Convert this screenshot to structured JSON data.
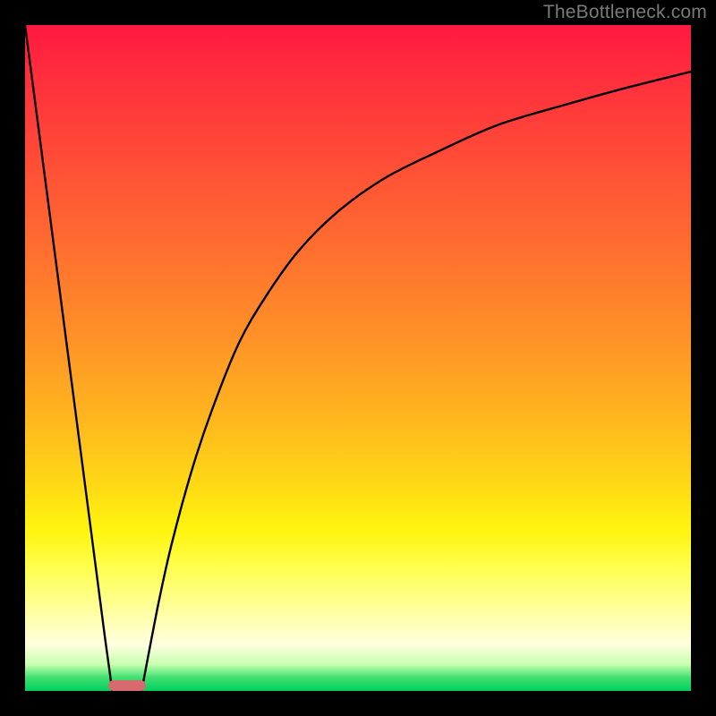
{
  "watermark": "TheBottleneck.com",
  "colors": {
    "marker": "#d76a6f",
    "frame": "#000000"
  },
  "chart_data": {
    "type": "line",
    "title": "",
    "xlabel": "",
    "ylabel": "",
    "xlim": [
      0,
      100
    ],
    "ylim": [
      0,
      100
    ],
    "marker": {
      "x_center": 15.3,
      "width_pct": 5.6
    },
    "series": [
      {
        "name": "left-descent",
        "x": [
          0,
          3,
          6,
          9,
          12,
          13.1
        ],
        "values": [
          100,
          77,
          54,
          31,
          8,
          0
        ]
      },
      {
        "name": "right-ascent",
        "x": [
          17.5,
          20,
          22,
          25,
          28,
          32,
          36,
          41,
          47,
          54,
          62,
          71,
          81,
          90,
          100
        ],
        "values": [
          0,
          13,
          22,
          33,
          42,
          52,
          59,
          66,
          72,
          77,
          81,
          85,
          88,
          90.5,
          93
        ]
      }
    ],
    "annotations": []
  }
}
